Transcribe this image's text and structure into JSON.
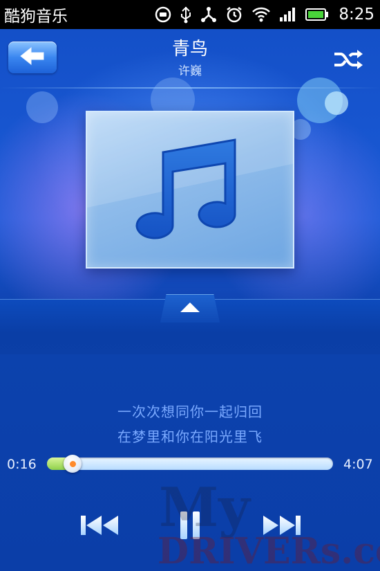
{
  "status_bar": {
    "app_name": "酷狗音乐",
    "time": "8:25",
    "icons": [
      "record-icon",
      "usb-icon",
      "share-icon",
      "alarm-icon",
      "wifi-icon",
      "signal-icon",
      "battery-icon"
    ]
  },
  "header": {
    "title": "青鸟",
    "artist": "许巍",
    "back_icon": "arrow-left-icon",
    "shuffle_icon": "shuffle-icon"
  },
  "album": {
    "icon": "music-note-icon"
  },
  "expand": {
    "icon": "triangle-up-icon"
  },
  "lyrics": [
    "一次次想同你一起归回",
    "在梦里和你在阳光里飞"
  ],
  "progress": {
    "current": "0:16",
    "total": "4:07",
    "fraction": 0.09
  },
  "controls": {
    "prev_icon": "previous-track-icon",
    "pause_icon": "pause-icon",
    "next_icon": "next-track-icon"
  },
  "watermark": {
    "text_top": "My",
    "text_bottom": "DRIVERs.com"
  },
  "colors": {
    "accent": "#1a5ad6",
    "lyric": "#7aa9ff",
    "progress_fill": "#8fd14a",
    "thumb_dot": "#ff8a2a"
  }
}
